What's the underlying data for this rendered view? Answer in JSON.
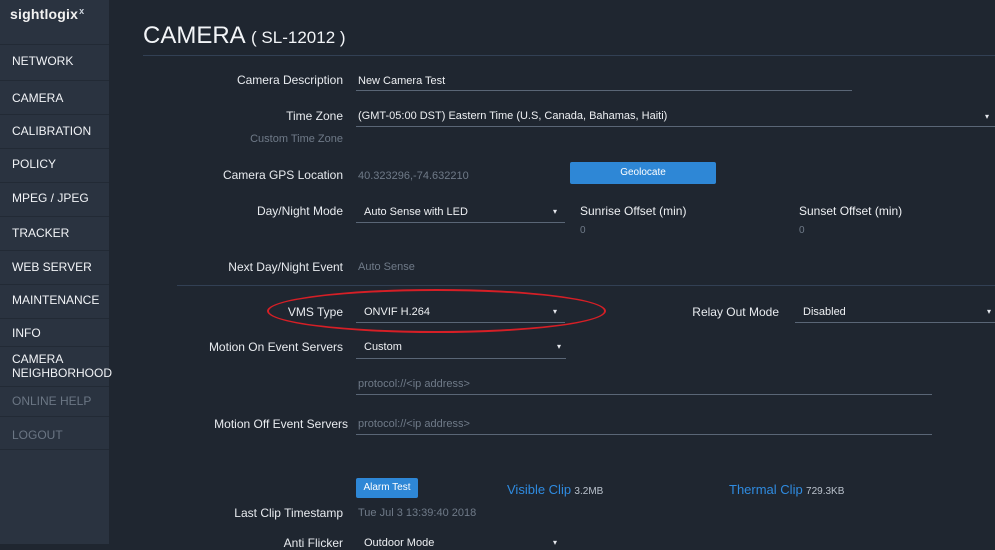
{
  "sidebar": {
    "logo": "sightlogix",
    "logo_mark": "x",
    "items": [
      {
        "label": "NETWORK"
      },
      {
        "label": "CAMERA"
      },
      {
        "label": "CALIBRATION"
      },
      {
        "label": "POLICY"
      },
      {
        "label": "MPEG / JPEG"
      },
      {
        "label": "TRACKER"
      },
      {
        "label": "WEB SERVER"
      },
      {
        "label": "MAINTENANCE"
      },
      {
        "label": "INFO"
      },
      {
        "label": "CAMERA NEIGHBORHOOD"
      },
      {
        "label": "ONLINE HELP"
      },
      {
        "label": "LOGOUT"
      }
    ]
  },
  "page": {
    "title": "CAMERA",
    "subtitle": "( SL-12012 )"
  },
  "form": {
    "camera_description_label": "Camera Description",
    "camera_description_value": "New Camera Test",
    "time_zone_label": "Time Zone",
    "time_zone_value": "(GMT-05:00 DST)  Eastern Time (U.S, Canada, Bahamas, Haiti)",
    "custom_time_zone_label": "Custom Time Zone",
    "gps_label": "Camera GPS Location",
    "gps_value": "40.323296,-74.632210",
    "geolocate_label": "Geolocate",
    "day_night_label": "Day/Night Mode",
    "day_night_value": "Auto Sense with LED",
    "sunrise_label": "Sunrise Offset (min)",
    "sunrise_value": "0",
    "sunset_label": "Sunset Offset (min)",
    "sunset_value": "0",
    "next_event_label": "Next Day/Night Event",
    "next_event_value": "Auto Sense",
    "vms_type_label": "VMS Type",
    "vms_type_value": "ONVIF H.264",
    "relay_out_label": "Relay Out Mode",
    "relay_out_value": "Disabled",
    "motion_on_label": "Motion On Event Servers",
    "motion_on_value": "Custom",
    "motion_on_placeholder": "protocol://<ip address>",
    "motion_off_label": "Motion Off Event Servers",
    "motion_off_placeholder": "protocol://<ip address>",
    "alarm_test_label": "Alarm Test",
    "visible_clip_label": "Visible Clip",
    "visible_clip_size": "3.2MB",
    "thermal_clip_label": "Thermal Clip",
    "thermal_clip_size": "729.3KB",
    "last_clip_label": "Last Clip Timestamp",
    "last_clip_value": "Tue Jul 3 13:39:40 2018",
    "anti_flicker_label": "Anti Flicker",
    "anti_flicker_value": "Outdoor Mode"
  },
  "icons": {
    "caret": "▾"
  },
  "colors": {
    "accent": "#2e87d6",
    "annotation": "#d61f26"
  }
}
